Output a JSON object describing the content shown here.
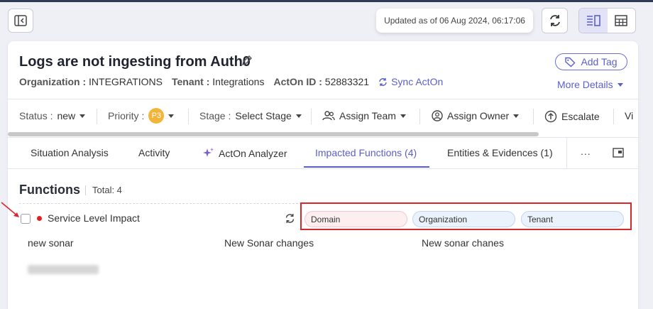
{
  "header": {
    "updated_text": "Updated as of 06 Aug 2024, 06:17:06"
  },
  "incident": {
    "title": "Logs are not ingesting from Auth0",
    "add_tag_label": "Add Tag",
    "more_details_label": "More Details",
    "meta": {
      "org_key": "Organization :",
      "org_value": "INTEGRATIONS",
      "tenant_key": "Tenant :",
      "tenant_value": "Integrations",
      "acton_key": "ActOn ID :",
      "acton_value": "52883321",
      "sync_label": "Sync ActOn"
    }
  },
  "actions": {
    "status_key": "Status :",
    "status_value": "new",
    "priority_key": "Priority :",
    "priority_badge": "P3",
    "stage_key": "Stage :",
    "stage_value": "Select Stage",
    "assign_team": "Assign Team",
    "assign_owner": "Assign Owner",
    "escalate": "Escalate",
    "cut_item": "Vi"
  },
  "tabs": [
    {
      "label": "Situation Analysis"
    },
    {
      "label": "Activity"
    },
    {
      "label": "ActOn Analyzer"
    },
    {
      "label": "Impacted Functions (4)"
    },
    {
      "label": "Entities & Evidences (1)"
    }
  ],
  "tabs_more": "...",
  "functions": {
    "heading": "Functions",
    "total": "Total: 4",
    "item_label": "Service Level Impact",
    "chips": {
      "domain": "Domain",
      "organization": "Organization",
      "tenant": "Tenant"
    },
    "values": [
      "new sonar",
      "New Sonar changes",
      "New sonar chanes"
    ]
  },
  "colors": {
    "accent": "#5b5fc7",
    "highlight_box": "#d9272e",
    "priority_p3": "#f2b53a"
  }
}
